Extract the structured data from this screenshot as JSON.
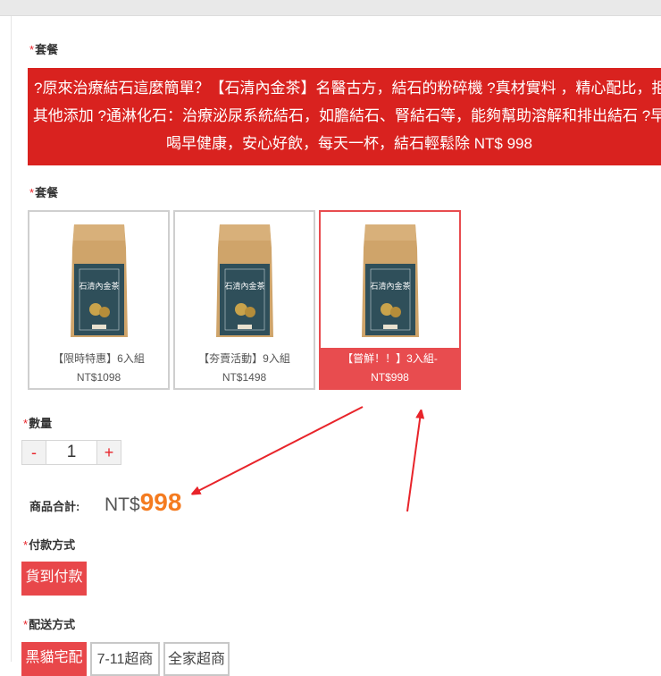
{
  "required_mark": "*",
  "sections": {
    "package_title_1": "套餐",
    "package_title_2": "套餐",
    "quantity_title": "數量",
    "payment_title": "付款方式",
    "shipping_title": "配送方式"
  },
  "promo": {
    "line1": "?原來治療結石這麼簡單？【石清內金茶】名醫古方，結石的粉碎機 ?真材實料 ，精心配比，拒絕",
    "line2": "其他添加 ?通淋化石：治療泌尿系統結石，如膽結石、腎結石等，能夠幫助溶解和排出結石 ?早",
    "line3": "喝早健康，安心好飲，每天一杯，結石輕鬆除 NT$ 998"
  },
  "packages": [
    {
      "line1": "【限時特惠】6入組",
      "line2": "NT$1098",
      "selected": false,
      "product_label": "石清內金茶"
    },
    {
      "line1": "【夯賣活動】9入組",
      "line2": "NT$1498",
      "selected": false,
      "product_label": "石清內金茶"
    },
    {
      "line1": "【嘗鮮！！】3入組-",
      "line2": "NT$998",
      "selected": true,
      "product_label": "石清內金茶"
    }
  ],
  "quantity": {
    "minus": "-",
    "value": "1",
    "plus": "+"
  },
  "total": {
    "label": "商品合計:",
    "currency": "NT$",
    "amount": "998"
  },
  "payment": {
    "options": [
      "貨到付款"
    ]
  },
  "shipping": {
    "options": [
      "黑貓宅配",
      "7-11超商",
      "全家超商"
    ]
  },
  "colors": {
    "accent_red": "#d9221f",
    "selected_red": "#e84c4f",
    "price_orange": "#f47b20",
    "arrow_red": "#e8242a"
  },
  "icons": {
    "product_image": "tea-bag-icon",
    "annotation": "red-arrow-icon"
  }
}
